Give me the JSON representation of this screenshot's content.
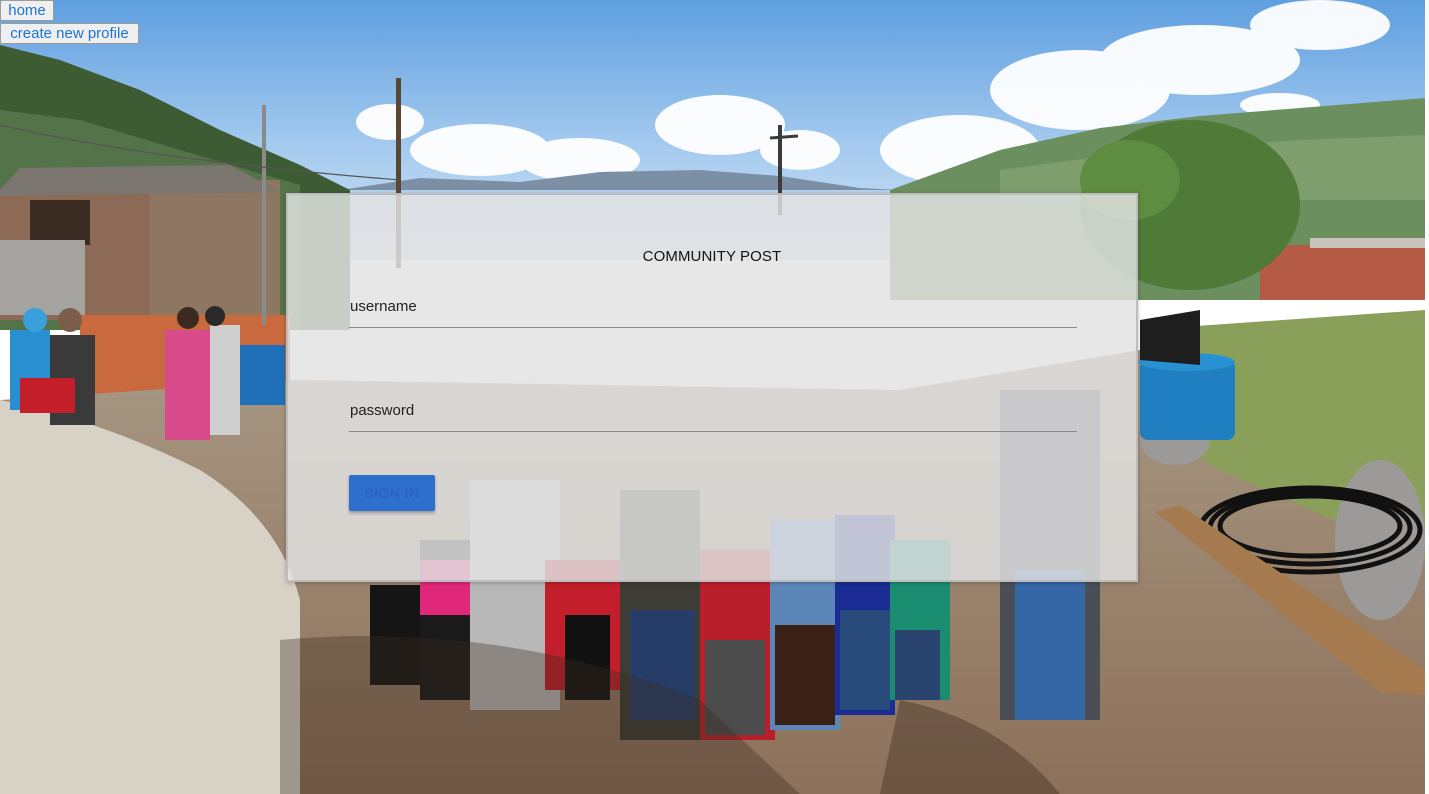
{
  "nav": {
    "home_label": "home",
    "create_profile_label": "create new profile"
  },
  "login": {
    "title": "COMMUNITY POST",
    "username_label": "username",
    "password_label": "password",
    "sign_in_label": "SIGN IN"
  },
  "colors": {
    "link_text": "#1a73d9",
    "button_primary": "#2e6fcd",
    "panel_background": "#e2e2e2"
  },
  "background": {
    "scene": "rural-village-gathering-photo"
  }
}
